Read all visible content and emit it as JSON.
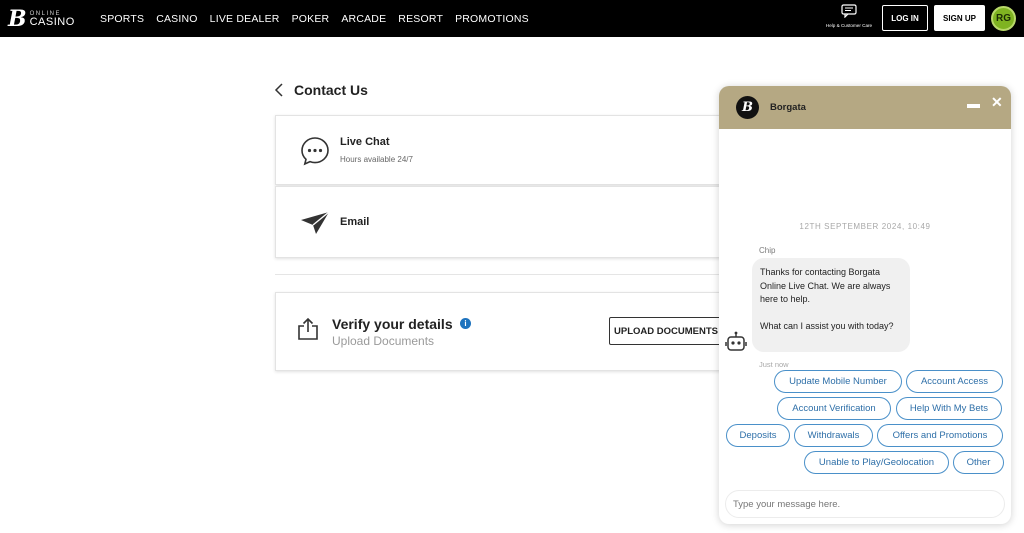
{
  "header": {
    "logo_online": "ONLINE",
    "logo_casino": "CASINO",
    "nav": [
      "SPORTS",
      "CASINO",
      "LIVE DEALER",
      "POKER",
      "ARCADE",
      "RESORT",
      "PROMOTIONS"
    ],
    "help_label": "Help & Customer Care",
    "login_label": "LOG IN",
    "signup_label": "SIGN UP",
    "rg_label": "RG"
  },
  "contact": {
    "title": "Contact Us",
    "live_chat": {
      "title": "Live Chat",
      "subtitle": "Hours available 24/7"
    },
    "email": {
      "title": "Email"
    },
    "verify": {
      "title": "Verify your details",
      "subtitle": "Upload Documents",
      "button_label": "UPLOAD DOCUMENTS",
      "info": "i"
    }
  },
  "chat": {
    "brand": "Borgata",
    "date": "12TH SEPTEMBER 2024, 10:49",
    "agent": "Chip",
    "message": [
      "Thanks for contacting Borgata Online Live Chat. We are always here to help.",
      "What can I assist you with today?"
    ],
    "time": "Just now",
    "quick_replies": [
      "Update Mobile Number",
      "Account Access",
      "Account Verification",
      "Help With My Bets",
      "Deposits",
      "Withdrawals",
      "Offers and Promotions",
      "Unable to Play/Geolocation",
      "Other"
    ],
    "input_placeholder": "Type your message here."
  },
  "colors": {
    "topbar": "#000000",
    "chat_header": "#b5a883",
    "quick_reply_border": "#4a90c9",
    "rg_green": "#7fb321",
    "info_blue": "#1e73be"
  }
}
